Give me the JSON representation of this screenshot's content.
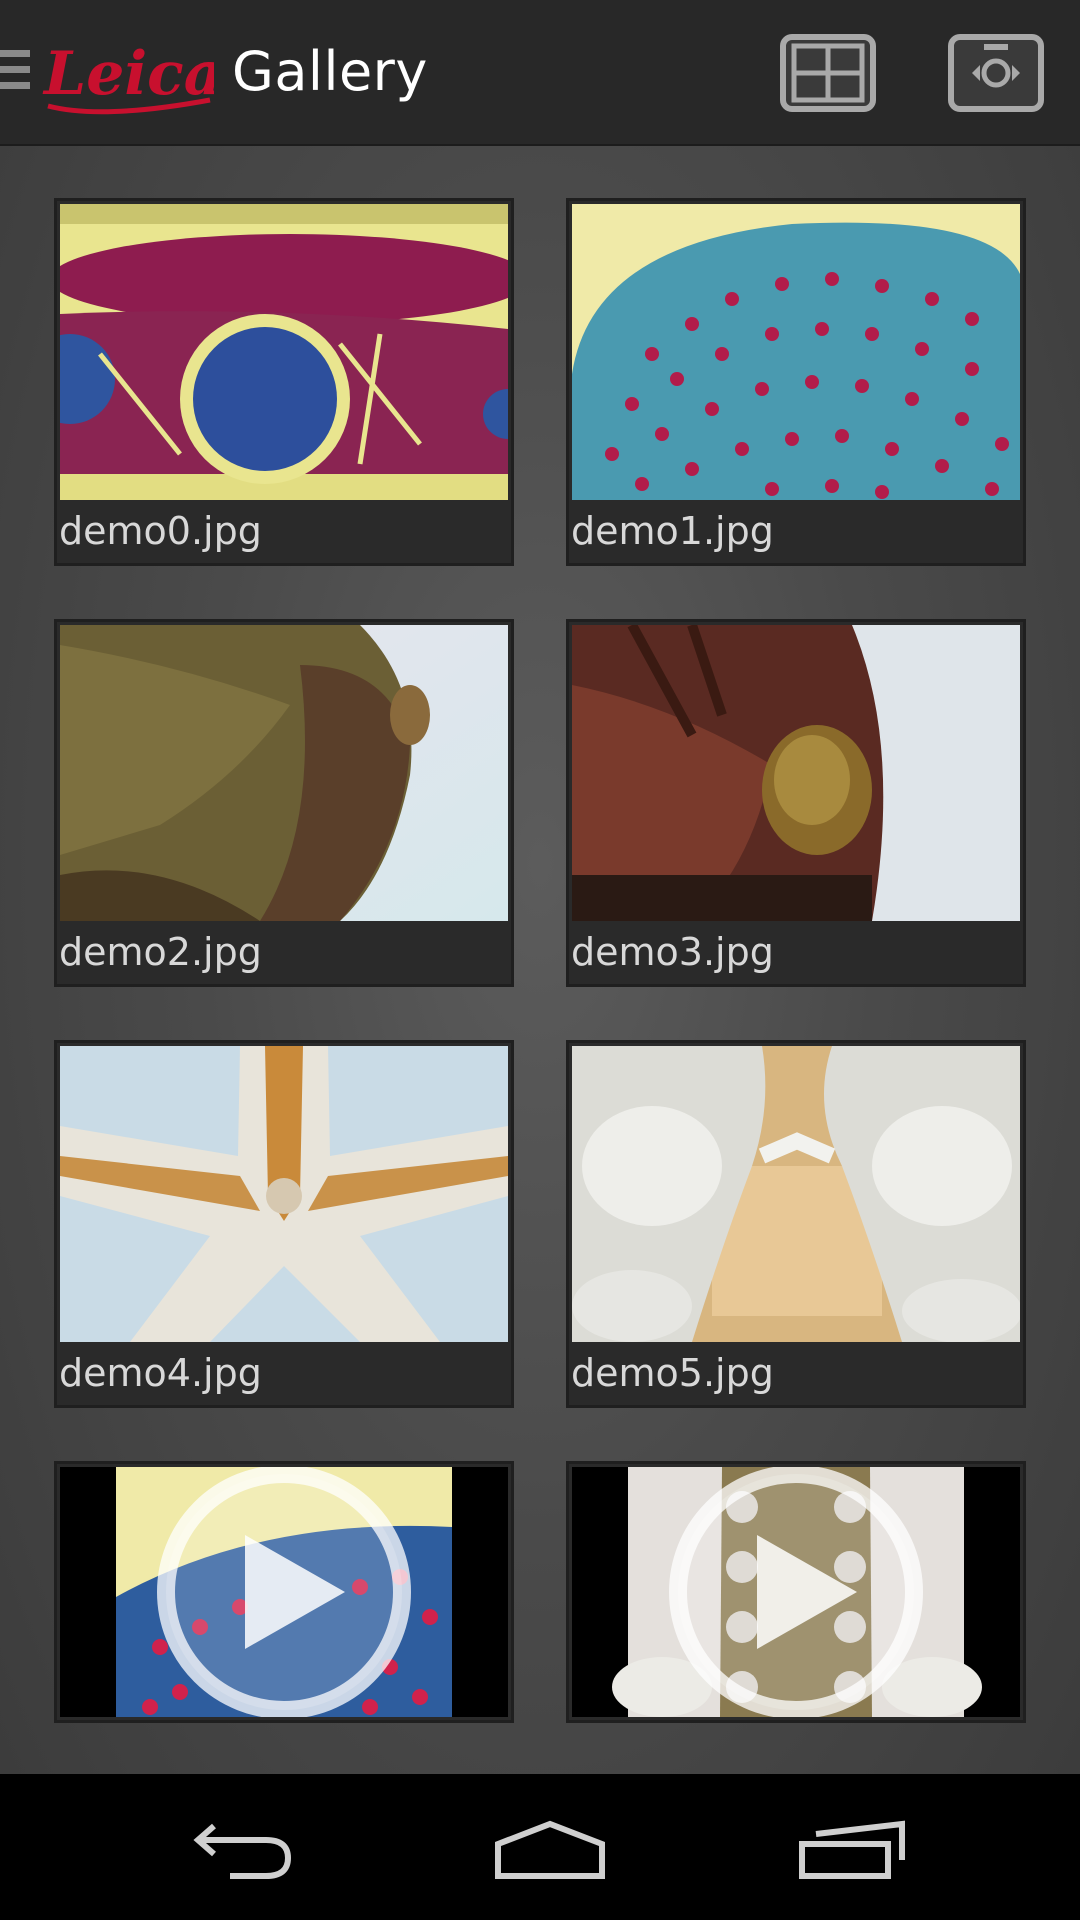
{
  "app": {
    "brand": "Leica",
    "title": "Gallery"
  },
  "toolbar": {
    "grid_icon": "grid-view-icon",
    "camera_icon": "switch-camera-icon"
  },
  "gallery": {
    "items": [
      {
        "name": "demo0.jpg",
        "type": "image",
        "subject": "stained tissue section"
      },
      {
        "name": "demo1.jpg",
        "type": "image",
        "subject": "cartilage cells"
      },
      {
        "name": "demo2.jpg",
        "type": "image",
        "subject": "insect close-up"
      },
      {
        "name": "demo3.jpg",
        "type": "image",
        "subject": "insect head"
      },
      {
        "name": "demo4.jpg",
        "type": "image",
        "subject": "starfish underside"
      },
      {
        "name": "demo5.jpg",
        "type": "image",
        "subject": "starfish detail"
      },
      {
        "name": "",
        "type": "video",
        "subject": "cartilage cells"
      },
      {
        "name": "",
        "type": "video",
        "subject": "starfish"
      }
    ]
  },
  "navigation": {
    "back_icon": "back-icon",
    "home_icon": "home-icon",
    "recents_icon": "recent-apps-icon"
  },
  "colors": {
    "action_bar": "#282828",
    "leica_red": "#c8102e",
    "title_text": "#ffffff",
    "caption_text": "#d8d8d8"
  }
}
